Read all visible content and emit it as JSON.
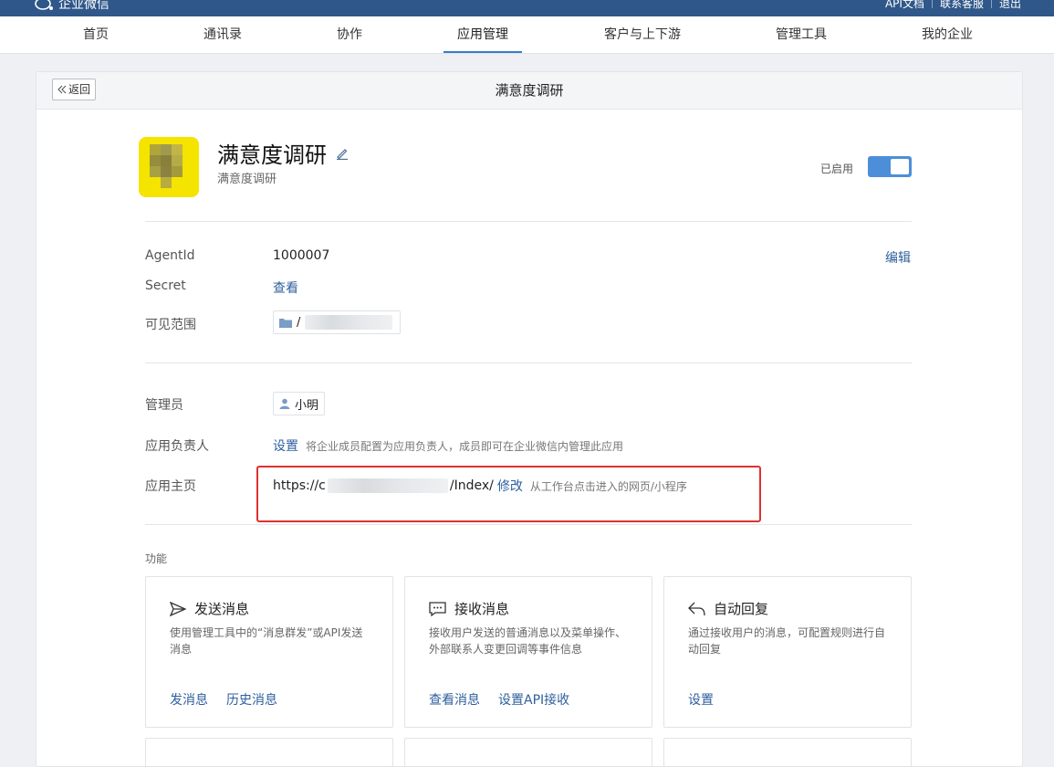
{
  "topbar": {
    "logo_text": "企业微信",
    "links": [
      "API文档",
      "联系客服",
      "退出"
    ]
  },
  "nav": {
    "tabs": [
      "首页",
      "通讯录",
      "协作",
      "应用管理",
      "客户与上下游",
      "管理工具",
      "我的企业"
    ],
    "active_tab": "应用管理"
  },
  "card": {
    "back_label": "返回",
    "title": "满意度调研"
  },
  "app": {
    "name": "满意度调研",
    "subtitle": "满意度调研",
    "status_label": "已启用",
    "enabled": true
  },
  "details": {
    "agentid_label": "AgentId",
    "agentid_value": "1000007",
    "edit_label": "编辑",
    "secret_label": "Secret",
    "secret_action": "查看",
    "scope_label": "可见范围",
    "scope_value_prefix": "/"
  },
  "admin": {
    "admin_label": "管理员",
    "admin_name": "小明",
    "owner_label": "应用负责人",
    "owner_action": "设置",
    "owner_hint": "将企业成员配置为应用负责人，成员即可在企业微信内管理此应用",
    "homepage_label": "应用主页",
    "homepage_prefix": "https://c",
    "homepage_suffix": "/Index/",
    "homepage_action": "修改",
    "homepage_hint": "从工作台点击进入的网页/小程序"
  },
  "features": {
    "section_label": "功能",
    "cards": [
      {
        "title": "发送消息",
        "icon": "send-icon",
        "desc": "使用管理工具中的“消息群发”或API发送消息",
        "actions": [
          "发消息",
          "历史消息"
        ]
      },
      {
        "title": "接收消息",
        "icon": "chat-icon",
        "desc": "接收用户发送的普通消息以及菜单操作、外部联系人变更回调等事件信息",
        "actions": [
          "查看消息",
          "设置API接收"
        ]
      },
      {
        "title": "自动回复",
        "icon": "reply-icon",
        "desc": "通过接收用户的消息，可配置规则进行自动回复",
        "actions": [
          "设置"
        ]
      }
    ]
  },
  "colors": {
    "topbar": "#2f5789",
    "accent": "#3a7bc8",
    "link": "#2e5f9e",
    "toggle_on": "#4c8fd8",
    "highlight_box": "#e03030"
  }
}
